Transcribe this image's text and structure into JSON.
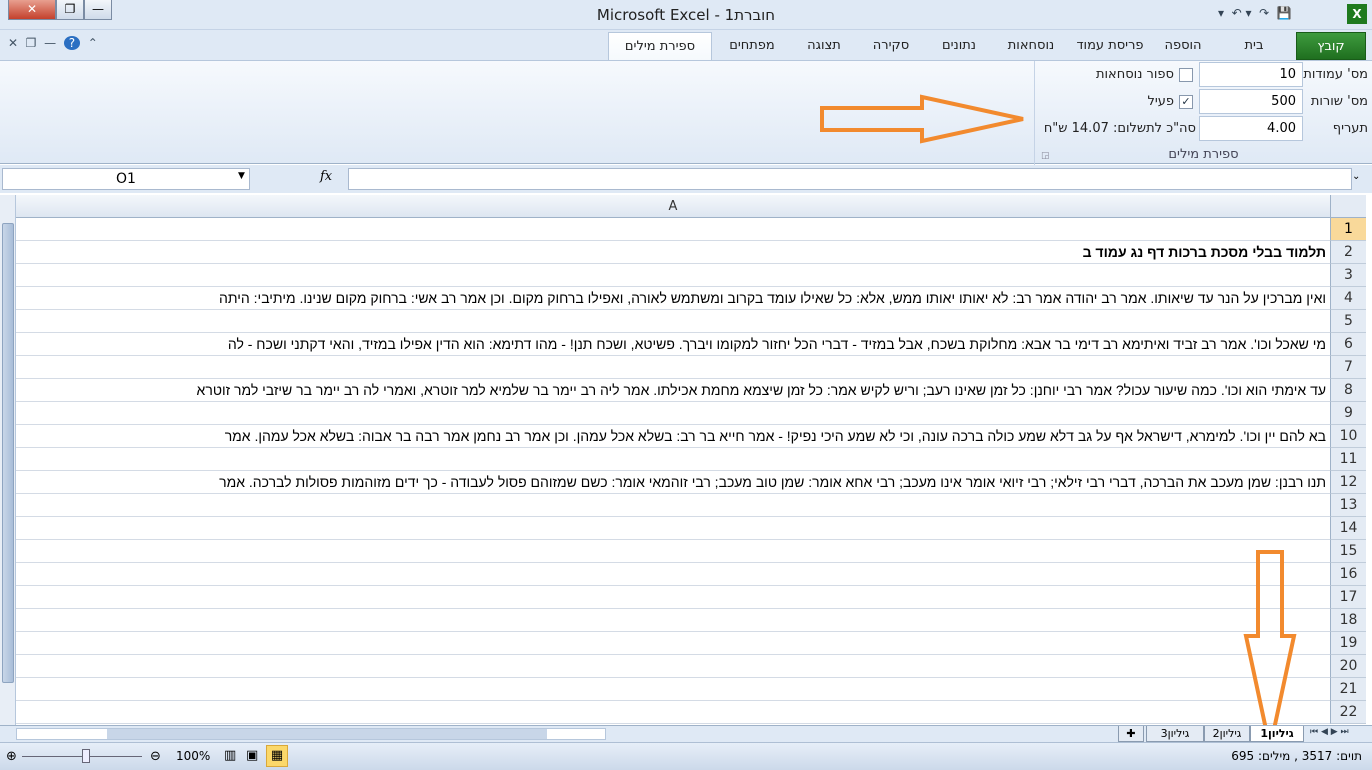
{
  "window": {
    "title": "Microsoft Excel - חוברת1",
    "close": "✕",
    "restore": "❐",
    "minimize": "—"
  },
  "ribbon_tabs": [
    "קובץ",
    "בית",
    "הוספה",
    "פריסת עמוד",
    "נוסחאות",
    "נתונים",
    "סקירה",
    "תצוגה",
    "מפתחים",
    "ספירת מילים"
  ],
  "word_count_group": {
    "label": "ספירת מילים",
    "columns_label": "מס' עמודות",
    "columns_value": "10",
    "rows_label": "מס' שורות",
    "rows_value": "500",
    "rate_label": "תעריף",
    "rate_value": "4.00",
    "formula_count_label": "ספור נוסחאות",
    "formula_count_checked": false,
    "active_label": "פעיל",
    "active_checked": true,
    "total": "סה\"כ לתשלום: 14.07 ש\"ח"
  },
  "formula_bar": {
    "name_box": "O1",
    "fx": "fx",
    "formula": ""
  },
  "sheet": {
    "column": "A",
    "selected_row": 1,
    "rows": [
      {
        "n": "1",
        "text": ""
      },
      {
        "n": "2",
        "text": "תלמוד בבלי מסכת ברכות דף נג עמוד ב"
      },
      {
        "n": "3",
        "text": ""
      },
      {
        "n": "4",
        "text": "ואין מברכין על הנר עד שיאותו. אמר רב יהודה אמר רב: לא יאותו יאותו ממש, אלא: כל שאילו עומד בקרוב ומשתמש לאורה, ואפילו ברחוק מקום. וכן אמר רב אשי: ברחוק מקום שנינו. מיתיבי: היתה"
      },
      {
        "n": "5",
        "text": ""
      },
      {
        "n": "6",
        "text": "מי שאכל וכו'. אמר רב זביד ואיתימא רב דימי בר אבא: מחלוקת בשכח, אבל במזיד - דברי הכל יחזור למקומו ויברך. פשיטא, ושכח תנן! - מהו דתימא: הוא הדין אפילו במזיד, והאי דקתני ושכח - לה"
      },
      {
        "n": "7",
        "text": ""
      },
      {
        "n": "8",
        "text": "עד אימתי הוא וכו'. כמה שיעור עכול? אמר רבי יוחנן: כל זמן שאינו רעב; וריש לקיש אמר: כל זמן שיצמא מחמת אכילתו. אמר ליה רב יימר בר שלמיא למר זוטרא, ואמרי לה רב יימר בר שיזבי למר זוטרא"
      },
      {
        "n": "9",
        "text": ""
      },
      {
        "n": "10",
        "text": "בא להם יין וכו'. למימרא, דישראל אף על גב דלא שמע כולה ברכה עונה, וכי לא שמע היכי נפיק! - אמר חייא בר רב: בשלא אכל עמהן. וכן אמר רב נחמן אמר רבה בר אבוה: בשלא אכל עמהן. אמר"
      },
      {
        "n": "11",
        "text": ""
      },
      {
        "n": "12",
        "text": "תנו רבנן: שמן מעכב את הברכה, דברי רבי זילאי; רבי זיואי אומר אינו מעכב; רבי אחא אומר: שמן טוב מעכב; רבי זוהמאי אומר: כשם שמזוהם פסול לעבודה - כך ידים מזוהמות פסולות לברכה. אמר"
      },
      {
        "n": "13",
        "text": ""
      },
      {
        "n": "14",
        "text": ""
      },
      {
        "n": "15",
        "text": ""
      },
      {
        "n": "16",
        "text": ""
      },
      {
        "n": "17",
        "text": ""
      },
      {
        "n": "18",
        "text": ""
      },
      {
        "n": "19",
        "text": ""
      },
      {
        "n": "20",
        "text": ""
      },
      {
        "n": "21",
        "text": ""
      },
      {
        "n": "22",
        "text": ""
      }
    ]
  },
  "sheet_tabs": [
    "גיליון1",
    "גיליון2",
    "גיליון3"
  ],
  "status": {
    "text": "תוים: 3517 , מילים: 695",
    "zoom": "100%"
  },
  "colors": {
    "file_tab": "#2a7f2a",
    "annotation": "#f28a2e",
    "selected_row": "#f9d99a"
  }
}
